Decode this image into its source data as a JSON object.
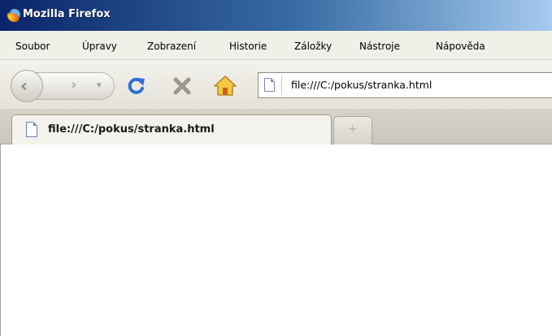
{
  "window": {
    "title": "Mozilla Firefox"
  },
  "menu": {
    "items": [
      "Soubor",
      "Úpravy",
      "Zobrazení",
      "Historie",
      "Záložky",
      "Nástroje",
      "Nápověda"
    ]
  },
  "toolbar": {
    "icons": [
      "back-icon",
      "forward-icon",
      "history-dropdown-icon",
      "reload-icon",
      "stop-icon",
      "home-icon"
    ],
    "colors": {
      "reload": "#2f6ed8",
      "stop": "#9a9890",
      "home": "#f2b321"
    }
  },
  "address": {
    "value": "file:///C:/pokus/stranka.html"
  },
  "tabs": [
    {
      "label": "file:///C:/pokus/stranka.html",
      "active": true
    }
  ],
  "new_tab": {
    "glyph": "+"
  },
  "colors": {
    "titlebar_start": "#0a246a",
    "titlebar_end": "#a6caf0",
    "chrome": "#f0efe8"
  }
}
